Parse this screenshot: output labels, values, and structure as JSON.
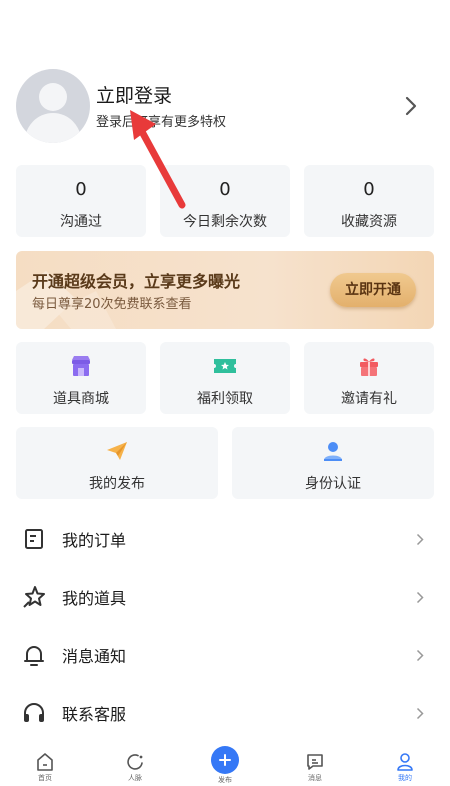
{
  "profile": {
    "title": "立即登录",
    "subtitle": "登录后可享有更多特权"
  },
  "stats": [
    {
      "value": "0",
      "label": "沟通过"
    },
    {
      "value": "0",
      "label": "今日剩余次数"
    },
    {
      "value": "0",
      "label": "收藏资源"
    }
  ],
  "vip": {
    "title": "开通超级会员，立享更多曝光",
    "subtitle": "每日尊享20次免费联系查看",
    "button": "立即开通"
  },
  "tools": [
    {
      "label": "道具商城",
      "icon": "shop-icon"
    },
    {
      "label": "福利领取",
      "icon": "ticket-icon"
    },
    {
      "label": "邀请有礼",
      "icon": "gift-icon"
    }
  ],
  "tools2": [
    {
      "label": "我的发布",
      "icon": "paper-plane-icon"
    },
    {
      "label": "身份认证",
      "icon": "id-user-icon"
    }
  ],
  "menu": [
    {
      "label": "我的订单",
      "icon": "order-icon"
    },
    {
      "label": "我的道具",
      "icon": "star-tool-icon"
    },
    {
      "label": "消息通知",
      "icon": "bell-icon"
    },
    {
      "label": "联系客服",
      "icon": "headset-icon"
    }
  ],
  "nav": [
    {
      "label": "首页",
      "icon": "home-icon"
    },
    {
      "label": "人脉",
      "icon": "contacts-icon"
    },
    {
      "label": "发布",
      "icon": "plus-icon"
    },
    {
      "label": "消息",
      "icon": "message-icon"
    },
    {
      "label": "我的",
      "icon": "user-icon",
      "active": true
    }
  ],
  "colors": {
    "accent": "#3578f6",
    "vip_text": "#5a3a1a",
    "annotation_arrow": "#e83a3a"
  }
}
